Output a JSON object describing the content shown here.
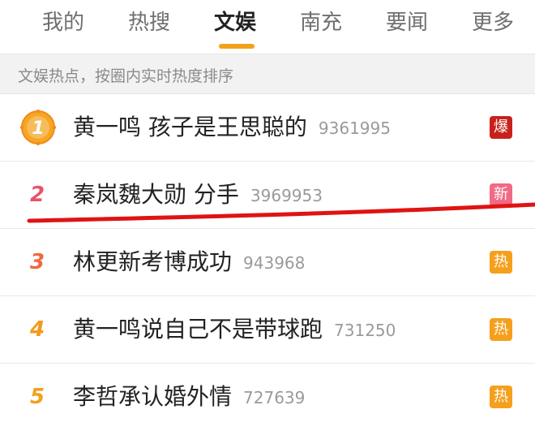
{
  "tabs": [
    {
      "label": "我的"
    },
    {
      "label": "热搜"
    },
    {
      "label": "文娱",
      "active": true
    },
    {
      "label": "南充"
    },
    {
      "label": "要闻"
    },
    {
      "label": "更多"
    }
  ],
  "subheader": {
    "text": "文娱热点，按圈内实时热度排序"
  },
  "items": [
    {
      "rank": "1",
      "title": "黄一鸣 孩子是王思聪的",
      "count": "9361995",
      "badge": "爆",
      "badge_color": "#c8211b"
    },
    {
      "rank": "2",
      "title": "秦岚魏大勋 分手",
      "count": "3969953",
      "badge": "新",
      "badge_color": "#f06a85"
    },
    {
      "rank": "3",
      "title": "林更新考博成功",
      "count": "943968",
      "badge": "热",
      "badge_color": "#f5a01d"
    },
    {
      "rank": "4",
      "title": "黄一鸣说自己不是带球跑",
      "count": "731250",
      "badge": "热",
      "badge_color": "#f5a01d"
    },
    {
      "rank": "5",
      "title": "李哲承认婚外情",
      "count": "727639",
      "badge": "热",
      "badge_color": "#f5a01d"
    }
  ],
  "colors": {
    "accent": "#f2a21a",
    "annotation": "#e01313"
  }
}
